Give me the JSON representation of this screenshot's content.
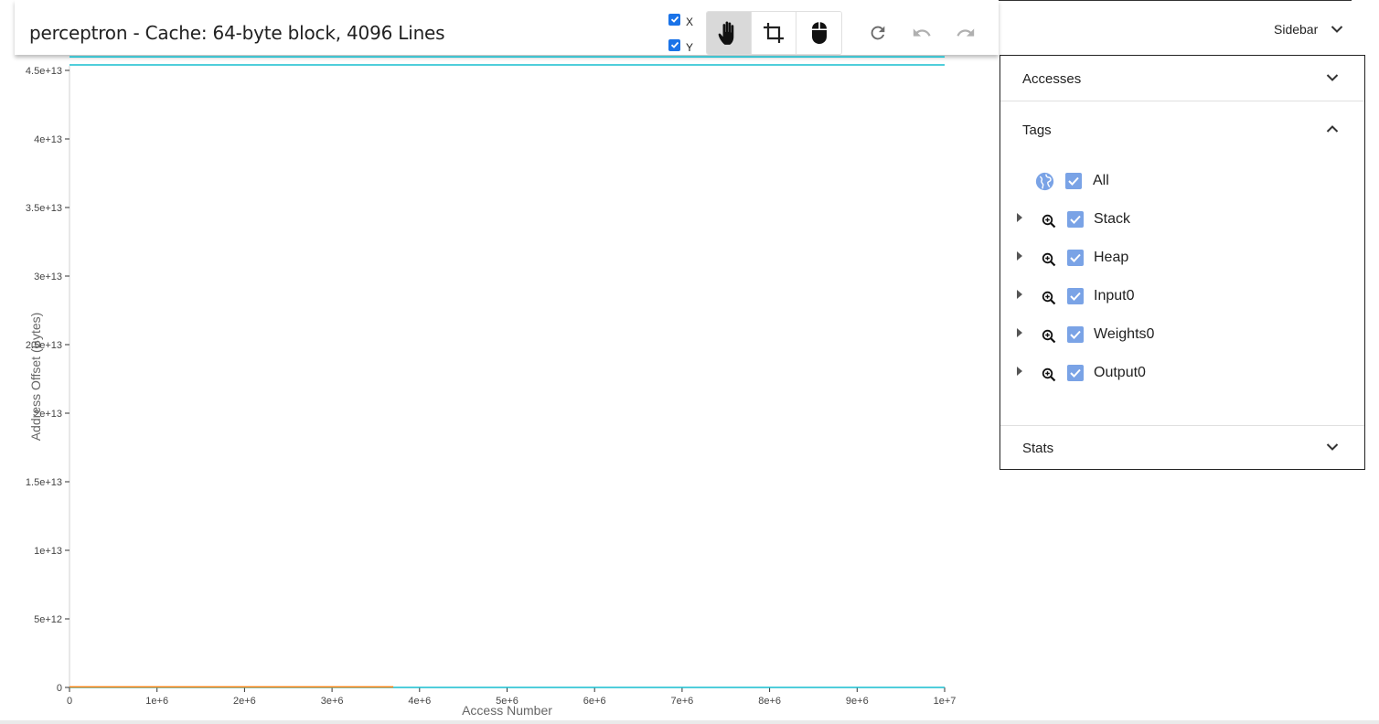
{
  "header": {
    "title": "perceptron - Cache: 64-byte block, 4096 Lines",
    "axis_x_label": "X",
    "axis_y_label": "Y",
    "sidebar_label": "Sidebar",
    "tools": [
      "pan-hand-icon",
      "crop-icon",
      "mouse-icon"
    ],
    "actions": [
      "refresh-icon",
      "undo-icon",
      "redo-icon"
    ]
  },
  "sidebar": {
    "accesses_title": "Accesses",
    "tags_title": "Tags",
    "stats_title": "Stats",
    "tags": [
      {
        "label": "All",
        "checked": true
      },
      {
        "label": "Stack",
        "checked": true
      },
      {
        "label": "Heap",
        "checked": true
      },
      {
        "label": "Input0",
        "checked": true
      },
      {
        "label": "Weights0",
        "checked": true
      },
      {
        "label": "Output0",
        "checked": true
      }
    ]
  },
  "colors": {
    "accent": "#1a73e8",
    "checkbox": "#7aa3e6",
    "series_teal": "#17becf",
    "series_orange": "#ff7f0e"
  },
  "chart_data": {
    "type": "scatter",
    "xlabel": "Access Number",
    "ylabel": "Address Offset (Bytes)",
    "xlim": [
      0,
      10000000
    ],
    "ylim": [
      0,
      46000000000000
    ],
    "x_ticks": [
      "0",
      "1e+6",
      "2e+6",
      "3e+6",
      "4e+6",
      "5e+6",
      "6e+6",
      "7e+6",
      "8e+6",
      "9e+6",
      "1e+7"
    ],
    "y_ticks": [
      "0",
      "5e+12",
      "1e+13",
      "1.5e+13",
      "2e+13",
      "2.5e+13",
      "3e+13",
      "3.5e+13",
      "4e+13",
      "4.5e+13"
    ],
    "x_tick_values": [
      0,
      1000000,
      2000000,
      3000000,
      4000000,
      5000000,
      6000000,
      7000000,
      8000000,
      9000000,
      10000000
    ],
    "y_tick_values": [
      0,
      5000000000000,
      10000000000000,
      15000000000000,
      20000000000000,
      25000000000000,
      30000000000000,
      35000000000000,
      40000000000000,
      45000000000000
    ],
    "series": [
      {
        "color": "#17becf",
        "segments": [
          [
            0,
            10000000,
            45990000000000
          ],
          [
            0,
            10000000,
            45400000000000
          ],
          [
            0,
            10000000,
            0
          ]
        ]
      },
      {
        "color": "#ff7f0e",
        "segments": [
          [
            0,
            3700000,
            40000000000
          ]
        ]
      }
    ],
    "grid": false
  }
}
